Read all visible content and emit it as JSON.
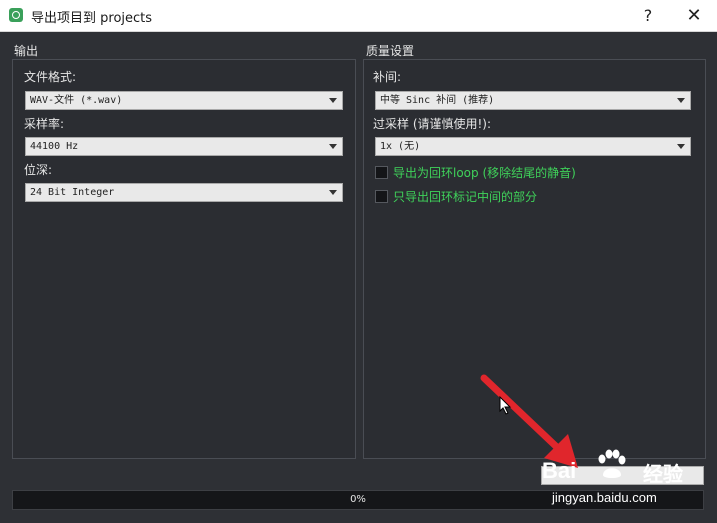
{
  "window": {
    "title": "导出项目到 projects",
    "help_symbol": "?",
    "close_symbol": "✕"
  },
  "output": {
    "section_title": "输出",
    "file_format": {
      "label": "文件格式:",
      "value": "WAV-文件 (*.wav)"
    },
    "sample_rate": {
      "label": "采样率:",
      "value": "44100 Hz"
    },
    "bit_depth": {
      "label": "位深:",
      "value": "24 Bit Integer"
    }
  },
  "quality": {
    "section_title": "质量设置",
    "interpolation": {
      "label": "补间:",
      "value": "中等 Sinc 补间 (推荐)"
    },
    "oversampling": {
      "label": "过采样 (请谨慎使用!):",
      "value": "1x (无)"
    },
    "export_loop": {
      "label": "导出为回环loop (移除结尾的静音)",
      "checked": false
    },
    "export_loop_markers": {
      "label": "只导出回环标记中间的部分",
      "checked": false
    }
  },
  "progress": {
    "value": 0,
    "text": "0%"
  },
  "watermark": {
    "brand": "Bai",
    "name": "经验",
    "url": "jingyan.baidu.com"
  },
  "colors": {
    "accent_green": "#3fd25a",
    "annotation_red": "#e0262c",
    "panel_bg": "#2b2d32"
  }
}
